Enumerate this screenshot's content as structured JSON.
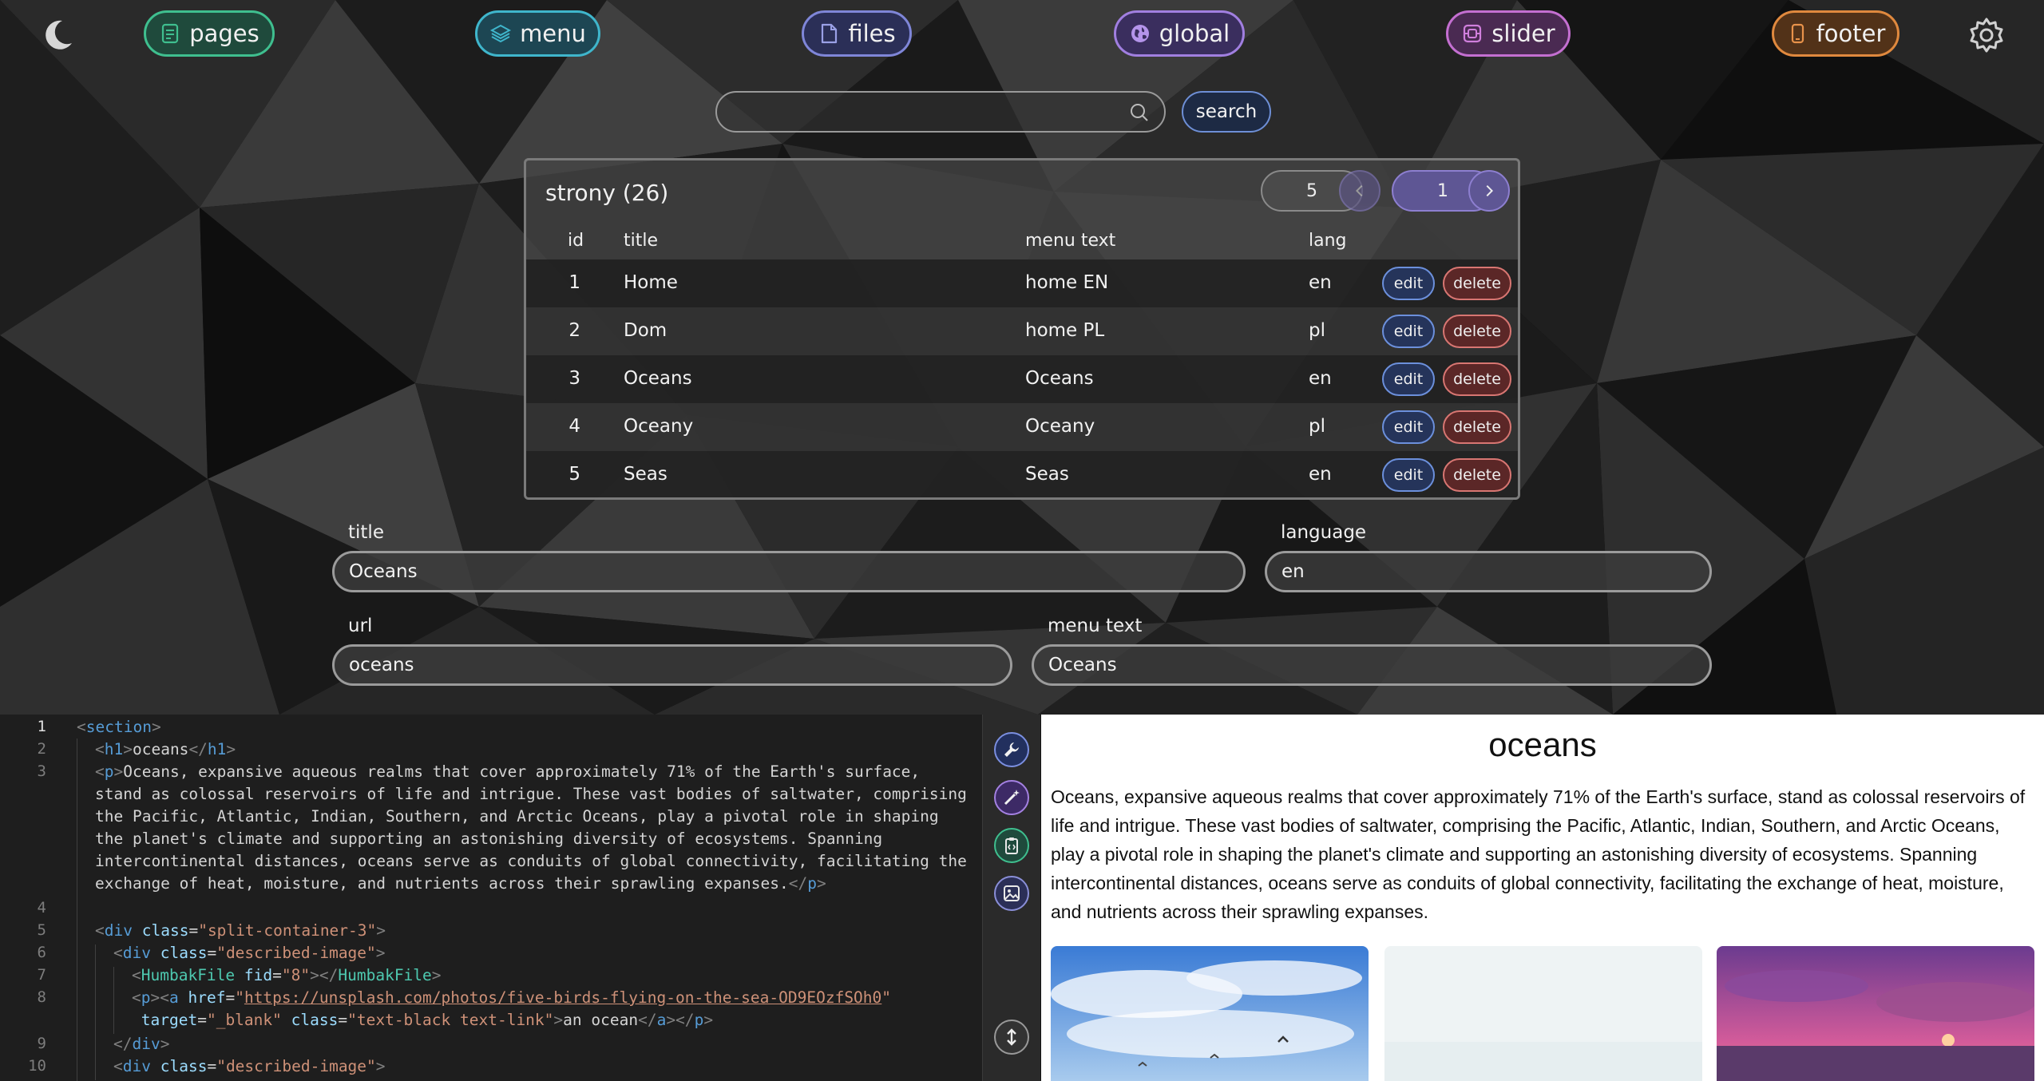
{
  "nav": {
    "items": [
      {
        "label": "pages",
        "icon": "document-icon",
        "color": "#3fbf8f",
        "bg": "#1f4a3c"
      },
      {
        "label": "menu",
        "icon": "layers-icon",
        "color": "#3fb6cc",
        "bg": "#1d4653"
      },
      {
        "label": "files",
        "icon": "file-icon",
        "color": "#7f86d8",
        "bg": "#2b2f57"
      },
      {
        "label": "global",
        "icon": "globe-icon",
        "color": "#a17fe0",
        "bg": "#3a2e5e"
      },
      {
        "label": "slider",
        "icon": "image-slider-icon",
        "color": "#c46fd1",
        "bg": "#4a2a52"
      },
      {
        "label": "footer",
        "icon": "mobile-icon",
        "color": "#e0893e",
        "bg": "#523218"
      }
    ]
  },
  "search": {
    "placeholder": "",
    "value": "",
    "button_label": "search"
  },
  "pages_table": {
    "title": "strony (26)",
    "page_size": "5",
    "current_page": "1",
    "columns": [
      "id",
      "title",
      "menu text",
      "lang"
    ],
    "edit_label": "edit",
    "delete_label": "delete",
    "rows": [
      {
        "id": "1",
        "title": "Home",
        "menu_text": "home EN",
        "lang": "en"
      },
      {
        "id": "2",
        "title": "Dom",
        "menu_text": "home PL",
        "lang": "pl"
      },
      {
        "id": "3",
        "title": "Oceans",
        "menu_text": "Oceans",
        "lang": "en"
      },
      {
        "id": "4",
        "title": "Oceany",
        "menu_text": "Oceany",
        "lang": "pl"
      },
      {
        "id": "5",
        "title": "Seas",
        "menu_text": "Seas",
        "lang": "en"
      }
    ]
  },
  "form": {
    "title_label": "title",
    "title_value": "Oceans",
    "language_label": "language",
    "language_value": "en",
    "url_label": "url",
    "url_value": "oceans",
    "menu_text_label": "menu text",
    "menu_text_value": "Oceans"
  },
  "editor": {
    "line_numbers": [
      "1",
      "2",
      "3",
      "4",
      "5",
      "6",
      "7",
      "8",
      "9",
      "10"
    ],
    "lines": {
      "l1_tag": "section",
      "l2_text": "oceans",
      "l3_text": [
        "Oceans, expansive aqueous realms that cover approximately 71% of the Earth's surface,",
        "stand as colossal reservoirs of life and intrigue. These vast bodies of saltwater, comprising",
        "the Pacific, Atlantic, Indian, Southern, and Arctic Oceans, play a pivotal role in shaping",
        "the planet's climate and supporting an astonishing diversity of ecosystems. Spanning",
        "intercontinental distances, oceans serve as conduits of global connectivity, facilitating the",
        "exchange of heat, moisture, and nutrients across their sprawling expanses."
      ],
      "l5_class": "split-container-3",
      "l6_class": "described-image",
      "l7_fid": "8",
      "l8_href": "https://unsplash.com/photos/five-birds-flying-on-the-sea-OD9EOzfSOh0",
      "l8_target": "_blank",
      "l8_class": "text-black text-link",
      "l8_text": "an ocean",
      "l10_class": "described-image"
    }
  },
  "tools": [
    "wrench-icon",
    "magic-wand-icon",
    "clipboard-code-icon",
    "image-icon",
    "vertical-resize-icon"
  ],
  "preview": {
    "title": "oceans",
    "text": "Oceans, expansive aqueous realms that cover approximately 71% of the Earth's surface, stand as colossal reservoirs of life and intrigue. These vast bodies of saltwater, comprising the Pacific, Atlantic, Indian, Southern, and Arctic Oceans, play a pivotal role in shaping the planet's climate and supporting an astonishing diversity of ecosystems. Spanning intercontinental distances, oceans serve as conduits of global connectivity, facilitating the exchange of heat, moisture, and nutrients across their sprawling expanses."
  }
}
